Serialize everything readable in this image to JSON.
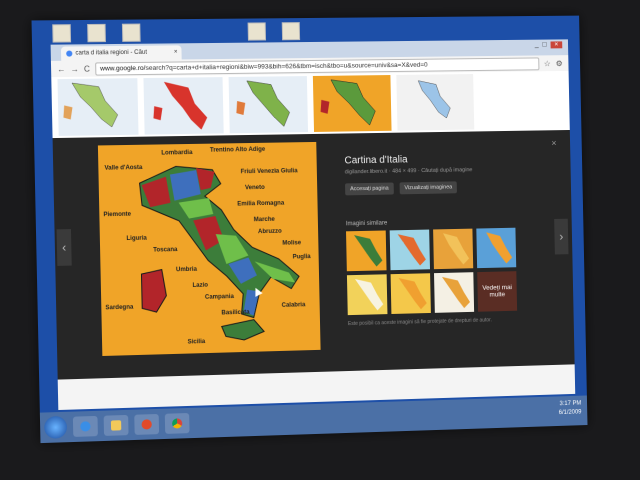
{
  "window": {
    "tab_title": "carta d italia regioni - Căut",
    "url_prefix": "www.google.ro",
    "url_rest": "/search?q=carta+d+italia+regioni&biw=993&bih=626&tbm=isch&tbo=u&source=univ&sa=X&ved=0",
    "nav_back": "←",
    "nav_forward": "→",
    "reload": "C"
  },
  "preview": {
    "title": "Cartina d'Italia",
    "meta": "digilander.libero.it · 484 × 499 · Căutați după imagine",
    "btn_visit": "Accesați pagina",
    "btn_view": "Vizualizați imaginea",
    "similar_title": "Imagini similare",
    "more_label": "Vedeți mai multe",
    "footnote": "Este posibil ca aceste imagini să fie protejate de drepturi de autor.",
    "map_labels": [
      "Lombardia",
      "Trentino Alto Adige",
      "Valle d'Aosta",
      "Friuli Venezia Giulia",
      "Veneto",
      "Emilia Romagna",
      "Piemonte",
      "Marche",
      "Abruzzo",
      "Liguria",
      "Molise",
      "Toscana",
      "Puglia",
      "Umbria",
      "Lazio",
      "Campania",
      "Sardegna",
      "Basilicata",
      "Calabria",
      "Sicilia"
    ]
  },
  "taskbar": {
    "time": "3:17 PM",
    "date": "6/1/2009"
  }
}
